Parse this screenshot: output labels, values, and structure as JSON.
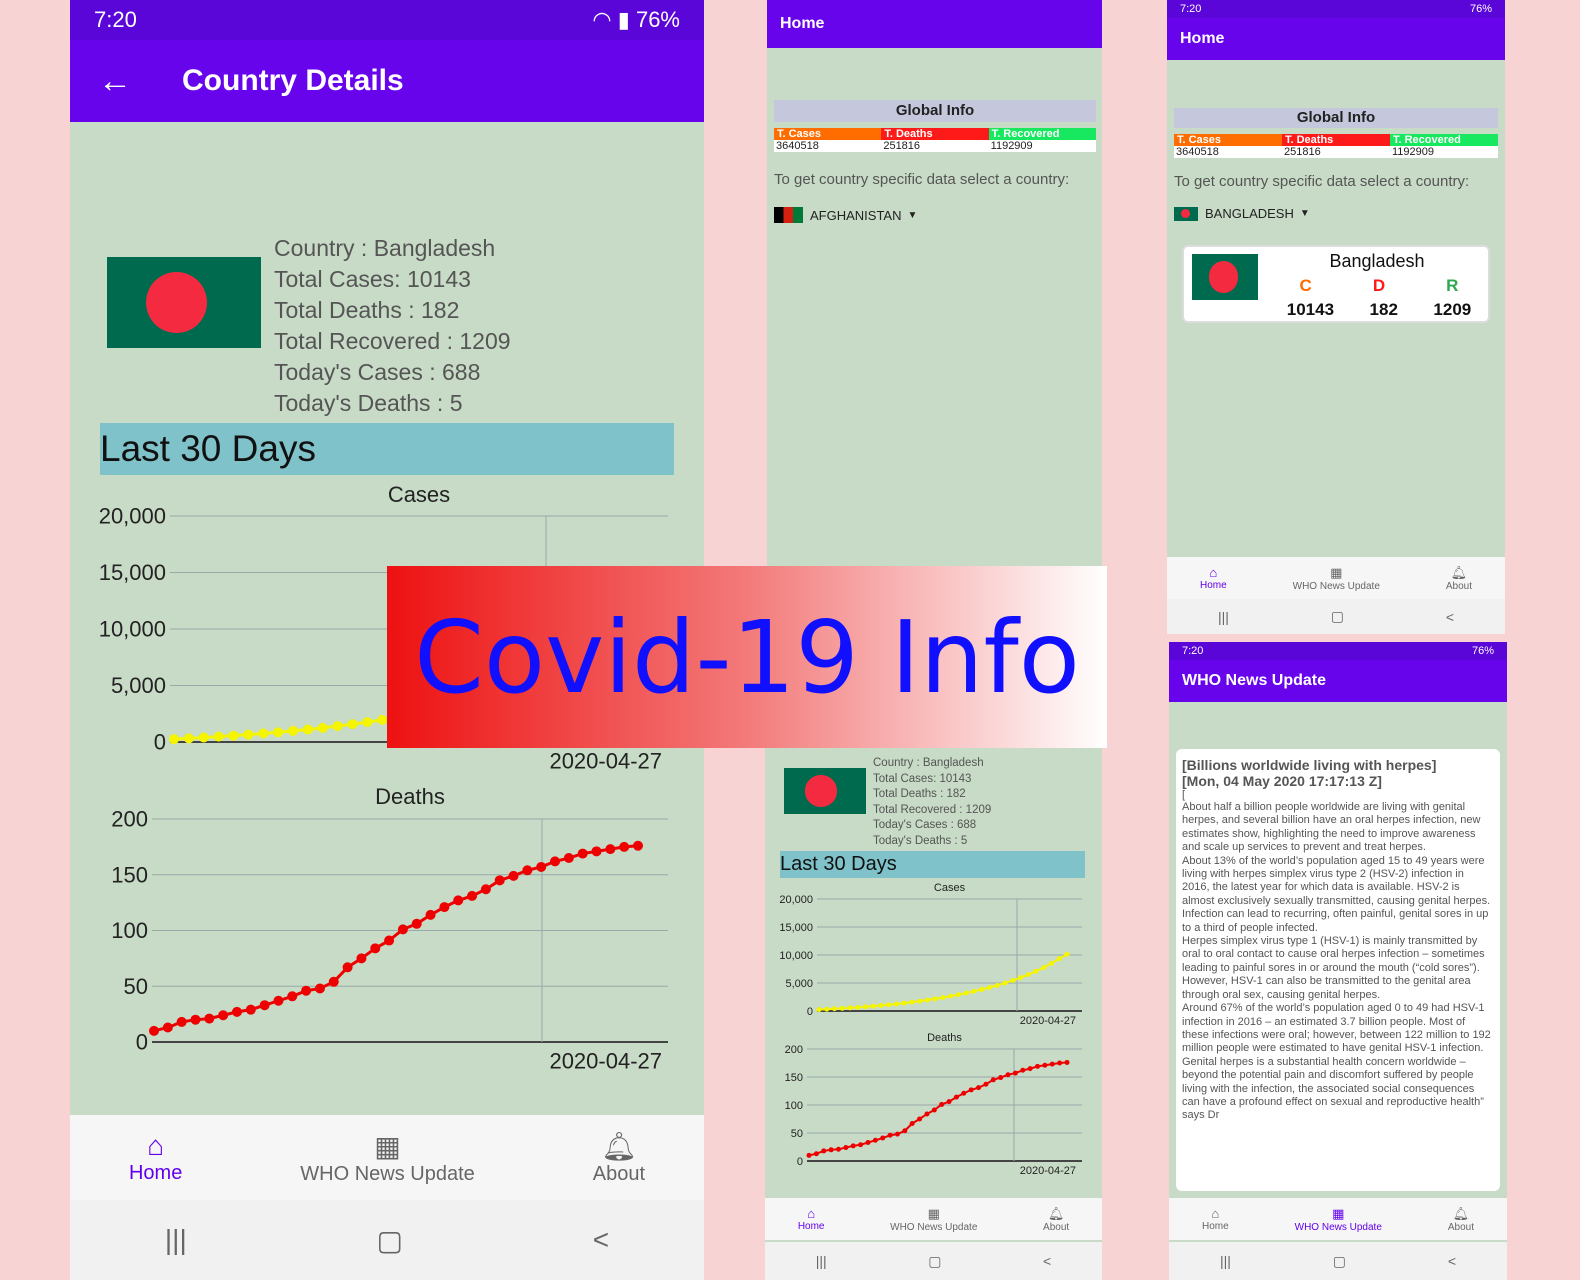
{
  "status": {
    "time": "7:20",
    "battery": "76%"
  },
  "details": {
    "title": "Country Details",
    "info_lines": [
      "Country : Bangladesh",
      "Total Cases: 10143",
      "Total Deaths : 182",
      "Total Recovered : 1209",
      "Today's Cases : 688",
      "Today's Deaths : 5"
    ],
    "section": "Last 30 Days"
  },
  "nav": {
    "home": "Home",
    "news": "WHO News Update",
    "about": "About"
  },
  "home": {
    "title": "Home",
    "global_title": "Global Info",
    "headers": [
      "T. Cases",
      "T. Deaths",
      "T. Recovered"
    ],
    "values": [
      "3640518",
      "251816",
      "1192909"
    ],
    "prompt": "To get country specific data select a country:",
    "country_a": "AFGHANISTAN",
    "country_b": "BANGLADESH"
  },
  "card": {
    "name": "Bangladesh",
    "labels": [
      "C",
      "D",
      "R"
    ],
    "values": [
      "10143",
      "182",
      "1209"
    ]
  },
  "news": {
    "title": "WHO News Update",
    "headline": "[Billions worldwide living with herpes]",
    "date": "[Mon, 04 May 2020 17:17:13 Z]",
    "bracket": "[",
    "body": "About half a billion people worldwide are living with genital herpes, and several billion have an oral herpes infection, new estimates show, highlighting the need to improve awareness and scale up services to prevent and treat herpes.\nAbout 13% of the world’s population aged 15 to 49 years were living with herpes simplex virus type 2 (HSV-2) infection in 2016, the latest year for which data is available.  HSV-2 is almost exclusively sexually transmitted, causing genital herpes. Infection can lead to recurring, often painful, genital sores in up to a third of people infected.\nHerpes simplex virus type 1 (HSV-1) is mainly transmitted by oral to oral contact to cause oral herpes infection – sometimes leading to painful sores in or around the mouth (“cold sores”). However, HSV-1 can also be transmitted to the genital area through oral sex, causing genital herpes.\nAround 67% of the world’s population aged 0 to 49 had HSV-1 infection in 2016 – an estimated 3.7 billion people. Most of these infections were oral; however, between 122 million to 192 million people were estimated to have genital HSV-1 infection.\nGenital herpes is a substantial health concern worldwide – beyond the potential pain and discomfort suffered by people living with the infection, the associated social consequences can have a profound effect on sexual and reproductive health” says Dr"
  },
  "banner": "Covid-19 Info",
  "colors": {
    "appbar": "#6804ec",
    "cases": "#ff6d00",
    "deaths": "#ff1a1a",
    "recovered": "#17e85f",
    "accent": "#6200ee"
  },
  "chart_data": [
    {
      "type": "line",
      "title": "Cases",
      "ylim": [
        0,
        20000
      ],
      "yticks": [
        "20,000",
        "15,000",
        "10,000",
        "5,000",
        "0"
      ],
      "xtick": "2020-04-27",
      "values": [
        250,
        320,
        400,
        480,
        560,
        650,
        750,
        860,
        980,
        1110,
        1250,
        1410,
        1580,
        1760,
        1960,
        2170,
        2400,
        2650,
        2920,
        3210,
        3520,
        3850,
        4200,
        4580,
        5000,
        5450,
        5950,
        6500,
        7100,
        7750,
        8500,
        9350,
        10143
      ]
    },
    {
      "type": "line",
      "title": "Deaths",
      "ylim": [
        0,
        200
      ],
      "yticks": [
        "200",
        "150",
        "100",
        "50",
        "0"
      ],
      "xtick": "2020-04-27",
      "values": [
        10,
        13,
        18,
        20,
        21,
        24,
        27,
        29,
        33,
        37,
        41,
        46,
        48,
        54,
        67,
        75,
        84,
        91,
        101,
        106,
        114,
        121,
        127,
        131,
        137,
        145,
        149,
        154,
        157,
        162,
        165,
        169,
        171,
        173,
        175,
        176
      ]
    }
  ]
}
